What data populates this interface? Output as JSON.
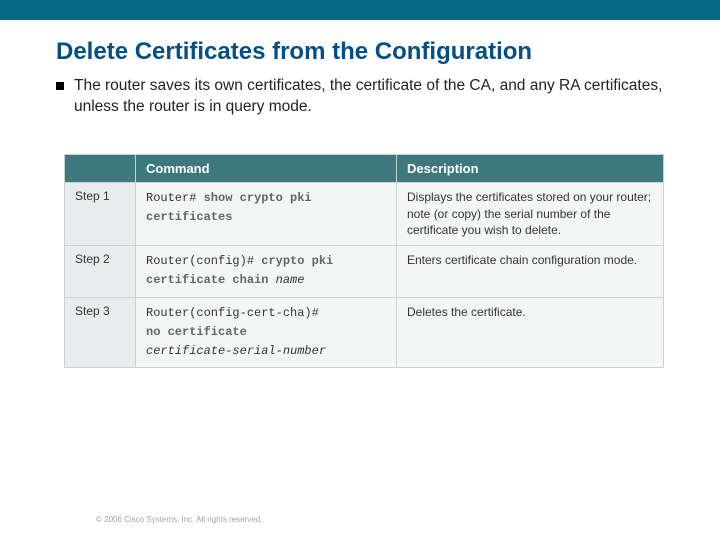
{
  "page": {
    "title": "Delete Certificates from the Configuration",
    "bullet": "The router saves its own certificates, the certificate of the CA, and any RA certificates, unless the router is in query mode."
  },
  "table": {
    "headers": {
      "command": "Command",
      "description": "Description"
    },
    "rows": [
      {
        "step": "Step 1",
        "prompt": "Router# ",
        "cmd_bold": "show crypto pki certificates",
        "cmd_ital": "",
        "desc": "Displays the certificates stored on your router; note (or copy) the serial number of the certificate you wish to delete."
      },
      {
        "step": "Step 2",
        "prompt": "Router(config)# ",
        "cmd_bold": "crypto pki certificate chain",
        "cmd_ital": " name",
        "desc": "Enters certificate chain configuration mode."
      },
      {
        "step": "Step 3",
        "prompt": "Router(config-cert-cha)# ",
        "cmd_bold": "no certificate",
        "cmd_ital": " certificate-serial-number",
        "desc": "Deletes the certificate."
      }
    ]
  },
  "footer": "© 2006 Cisco Systems, Inc. All rights reserved."
}
